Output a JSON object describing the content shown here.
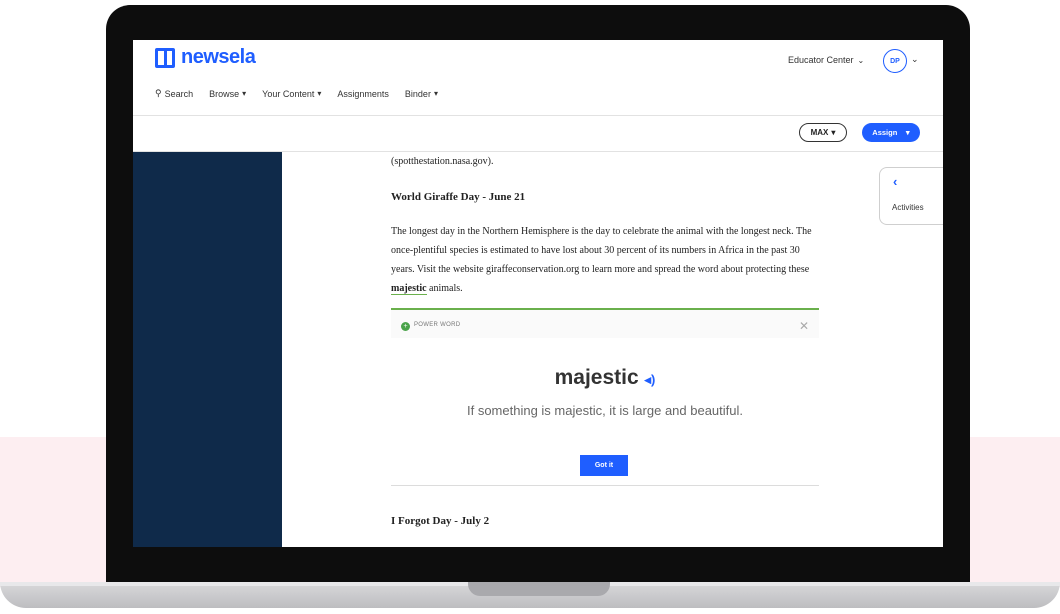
{
  "app": {
    "logo_text": "newsela"
  },
  "nav": {
    "search": "Search",
    "browse": "Browse",
    "your_content": "Your Content",
    "assignments": "Assignments",
    "binder": "Binder",
    "educator_center": "Educator Center",
    "avatar_initials": "DP"
  },
  "toolbar": {
    "level": "MAX",
    "assign": "Assign"
  },
  "article": {
    "prev_tail": "(spotthestation.nasa.gov).",
    "section1_title": "World Giraffe Day - June 21",
    "section1_text_before": "The longest day in the Northern Hemisphere is the day to celebrate the animal with the longest neck. The once-plentiful species is estimated to have lost about 30 percent of its numbers in Africa in the past 30 years. Visit the website giraffeconservation.org to learn more and spread the word about protecting these ",
    "section1_power_word": "majestic",
    "section1_text_after": " animals.",
    "section2_title": "I Forgot Day - July 2"
  },
  "power_word": {
    "label": "POWER WORD",
    "word": "majestic",
    "definition": "If something is majestic, it is large and beautiful.",
    "button": "Got it"
  },
  "activities": {
    "label": "Activities"
  },
  "colors": {
    "brand_blue": "#1f5eff",
    "sidebar_navy": "#0f2a4a",
    "power_green": "#6ab04c",
    "bg_pink": "#fdeef1"
  }
}
